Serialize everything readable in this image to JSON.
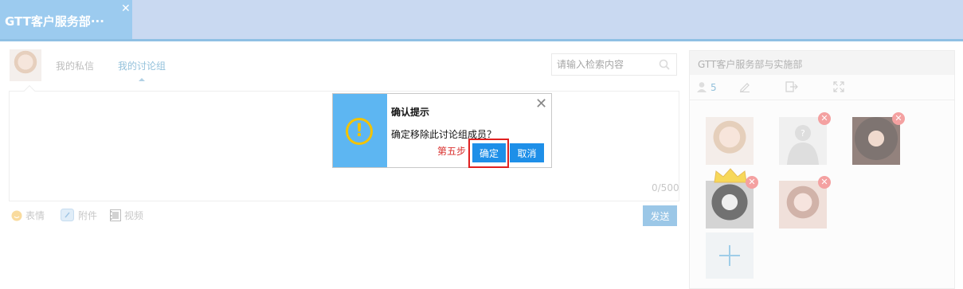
{
  "tab": {
    "title": "GTT客户服务部···",
    "close": "✕"
  },
  "nav": {
    "private_messages": "我的私信",
    "discussion_groups": "我的讨论组"
  },
  "search": {
    "placeholder": "请输入检索内容"
  },
  "editor": {
    "counter": "0/500"
  },
  "tools": {
    "emoji": "表情",
    "attachment": "附件",
    "video": "视频",
    "send": "发送"
  },
  "group_panel": {
    "title": "GTT客户服务部与实施部",
    "member_count": "5",
    "remove_glyph": "✕"
  },
  "dialog": {
    "title": "确认提示",
    "message": "确定移除此讨论组成员？",
    "icon_glyph": "!",
    "close_glyph": "✕",
    "confirm": "确定",
    "cancel": "取消"
  },
  "annotation": {
    "step": "第五步"
  },
  "colors": {
    "accent": "#1e8fe8",
    "tab": "#9ccbef",
    "warning": "#f3c300",
    "remove": "#ef6f6f",
    "highlight": "#e02020"
  }
}
